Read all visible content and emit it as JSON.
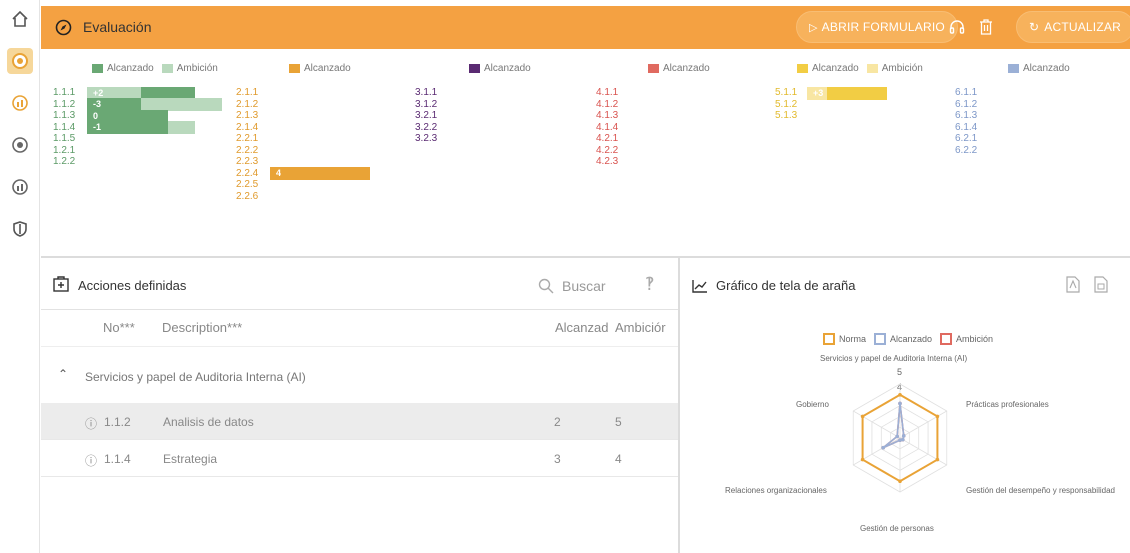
{
  "header": {
    "title": "Evaluación",
    "open_form_label": "ABRIR FORMULARIO",
    "refresh_label": "ACTUALIZAR",
    "color": "#f4a142"
  },
  "chart_data": [
    {
      "type": "bar",
      "series": [
        {
          "name": "Alcanzado",
          "color": "#6aa874"
        },
        {
          "name": "Ambición",
          "color": "#b9d9bd"
        }
      ],
      "categories": [
        "1.1.1",
        "1.1.2",
        "1.1.3",
        "1.1.4",
        "1.1.5",
        "1.2.1",
        "1.2.2"
      ],
      "bars": [
        {
          "code": "1.1.1",
          "alcanzado": 4,
          "ambicion": 2,
          "label": "+2"
        },
        {
          "code": "1.1.2",
          "alcanzado": 2,
          "ambicion": 5,
          "label": "-3"
        },
        {
          "code": "1.1.3",
          "alcanzado": 3,
          "ambicion": 3,
          "label": "0"
        },
        {
          "code": "1.1.4",
          "alcanzado": 3,
          "ambicion": 4,
          "label": "-1"
        }
      ],
      "code_color": "#5b9a66"
    },
    {
      "type": "bar",
      "series": [
        {
          "name": "Alcanzado",
          "color": "#e9a336"
        }
      ],
      "categories": [
        "2.1.1",
        "2.1.2",
        "2.1.3",
        "2.1.4",
        "2.2.1",
        "2.2.2",
        "2.2.3",
        "2.2.4",
        "2.2.5",
        "2.2.6"
      ],
      "bars": [
        {
          "code": "2.2.4",
          "alcanzado": 4,
          "label": "4"
        }
      ],
      "code_color": "#e09a2c"
    },
    {
      "type": "bar",
      "series": [
        {
          "name": "Alcanzado",
          "color": "#5a2a72"
        }
      ],
      "categories": [
        "3.1.1",
        "3.1.2",
        "3.2.1",
        "3.2.2",
        "3.2.3"
      ],
      "bars": [],
      "code_color": "#5a2a72"
    },
    {
      "type": "bar",
      "series": [
        {
          "name": "Alcanzado",
          "color": "#e06a60"
        }
      ],
      "categories": [
        "4.1.1",
        "4.1.2",
        "4.1.3",
        "4.1.4",
        "4.2.1",
        "4.2.2",
        "4.2.3"
      ],
      "bars": [],
      "code_color": "#d9534f"
    },
    {
      "type": "bar",
      "series": [
        {
          "name": "Alcanzado",
          "color": "#f2cd44"
        },
        {
          "name": "Ambición",
          "color": "#f8e6a3"
        }
      ],
      "categories": [
        "5.1.1",
        "5.1.2",
        "5.1.3"
      ],
      "bars": [
        {
          "code": "5.1.1",
          "alcanzado": 4,
          "ambicion": 1,
          "label": "+3"
        }
      ],
      "code_color": "#e2ba2c"
    },
    {
      "type": "bar",
      "series": [
        {
          "name": "Alcanzado",
          "color": "#9bb0d6"
        }
      ],
      "categories": [
        "6.1.1",
        "6.1.2",
        "6.1.3",
        "6.1.4",
        "6.2.1",
        "6.2.2"
      ],
      "bars": [],
      "code_color": "#7d97c8"
    },
    {
      "type": "radar",
      "legend": [
        "Norma",
        "Alcanzado",
        "Ambición"
      ],
      "axes": [
        "Servicios y papel de Auditoria Interna (AI)",
        "Prácticas profesionales",
        "Gestión del desempeño y responsabilidad",
        "Gestión de personas",
        "Relaciones organizacionales",
        "Gobierno"
      ],
      "tick_labels": [
        "5",
        "4"
      ],
      "rmax": 5,
      "series": [
        {
          "name": "Norma",
          "color": "#e9a336",
          "values": [
            4,
            4,
            4,
            4,
            4,
            4
          ]
        },
        {
          "name": "Alcanzado",
          "color": "#9bb0d6",
          "values": [
            3.2,
            0.4,
            0.3,
            0.2,
            1.8,
            0.3
          ]
        },
        {
          "name": "Ambición",
          "color": "#e06a60",
          "values": [
            3.2,
            0.4,
            0.3,
            0.2,
            1.8,
            0.3
          ]
        }
      ]
    }
  ],
  "actions": {
    "title": "Acciones definidas",
    "search_placeholder": "Buscar",
    "columns": {
      "no": "No***",
      "description": "Description***",
      "alcanzado": "Alcanzad",
      "ambicion": "Ambiciór"
    },
    "group": "Servicios y papel de Auditoria Interna (AI)",
    "rows": [
      {
        "no": "1.1.2",
        "description": "Analisis de datos",
        "alcanzado": "2",
        "ambicion": "5"
      },
      {
        "no": "1.1.4",
        "description": "Estrategia",
        "alcanzado": "3",
        "ambicion": "4"
      }
    ]
  },
  "radar_panel": {
    "title": "Gráfico de tela de araña"
  }
}
